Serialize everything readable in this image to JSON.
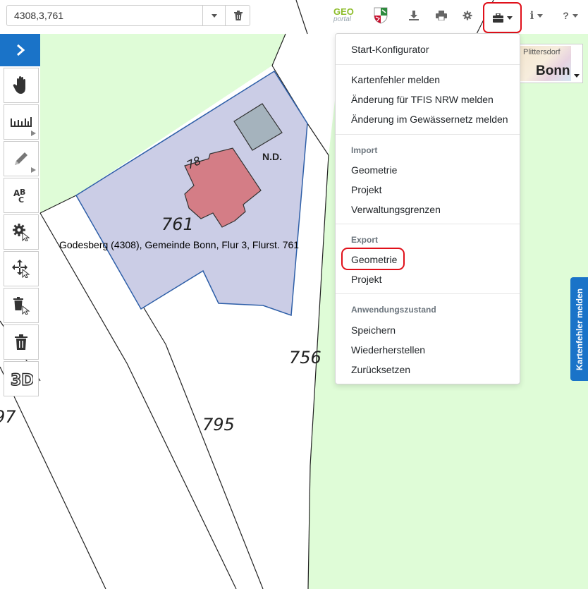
{
  "search": {
    "value": "4308,3,761"
  },
  "header": {
    "geo_logo_top": "GEO",
    "geo_logo_bottom": "portal"
  },
  "tools_menu": {
    "start_configurator": "Start-Konfigurator",
    "report_map_error": "Kartenfehler melden",
    "report_tfis": "Änderung für TFIS NRW melden",
    "report_water": "Änderung im Gewässernetz melden",
    "import_header": "Import",
    "import_geometry": "Geometrie",
    "import_project": "Projekt",
    "import_admin_borders": "Verwaltungsgrenzen",
    "export_header": "Export",
    "export_geometry": "Geometrie",
    "export_project": "Projekt",
    "app_state_header": "Anwendungszustand",
    "save": "Speichern",
    "restore": "Wiederherstellen",
    "reset": "Zurücksetzen"
  },
  "basemap": {
    "label_small": "Plittersdorf",
    "label_big": "Bonn"
  },
  "side_tab": {
    "label": "Kartenfehler melden"
  },
  "map": {
    "parcel_tooltip": "Godesberg (4308), Gemeinde Bonn, Flur 3, Flurst. 761",
    "labels": {
      "parcel_761": "761",
      "parcel_756": "756",
      "parcel_795": "795",
      "parcel_97": "97",
      "house_number": "78",
      "nd": "N.D."
    },
    "colors": {
      "green_area": "#dffcd7",
      "selected_parcel": "#cbcde6",
      "building": "#d47d86",
      "outbuilding": "#a5b3bd"
    }
  },
  "colors": {
    "accent": "#1a73c8",
    "highlight": "#e0101a"
  },
  "icons": {
    "search_dropdown": "chevron-down-icon",
    "search_clear": "trash-icon",
    "state_logo": "nrw-coat-of-arms",
    "download": "download-icon",
    "print": "printer-icon",
    "settings": "gear-icon",
    "tools": "briefcase-icon",
    "info": "info-icon",
    "help": "question-icon",
    "expand": "chevron-right-icon",
    "toolbar": [
      "hand-icon",
      "ruler-icon",
      "pencil-icon",
      "text-abc-icon",
      "gear-edit-icon",
      "move-icon",
      "delete-select-icon",
      "trash-icon",
      "3d-icon"
    ]
  }
}
